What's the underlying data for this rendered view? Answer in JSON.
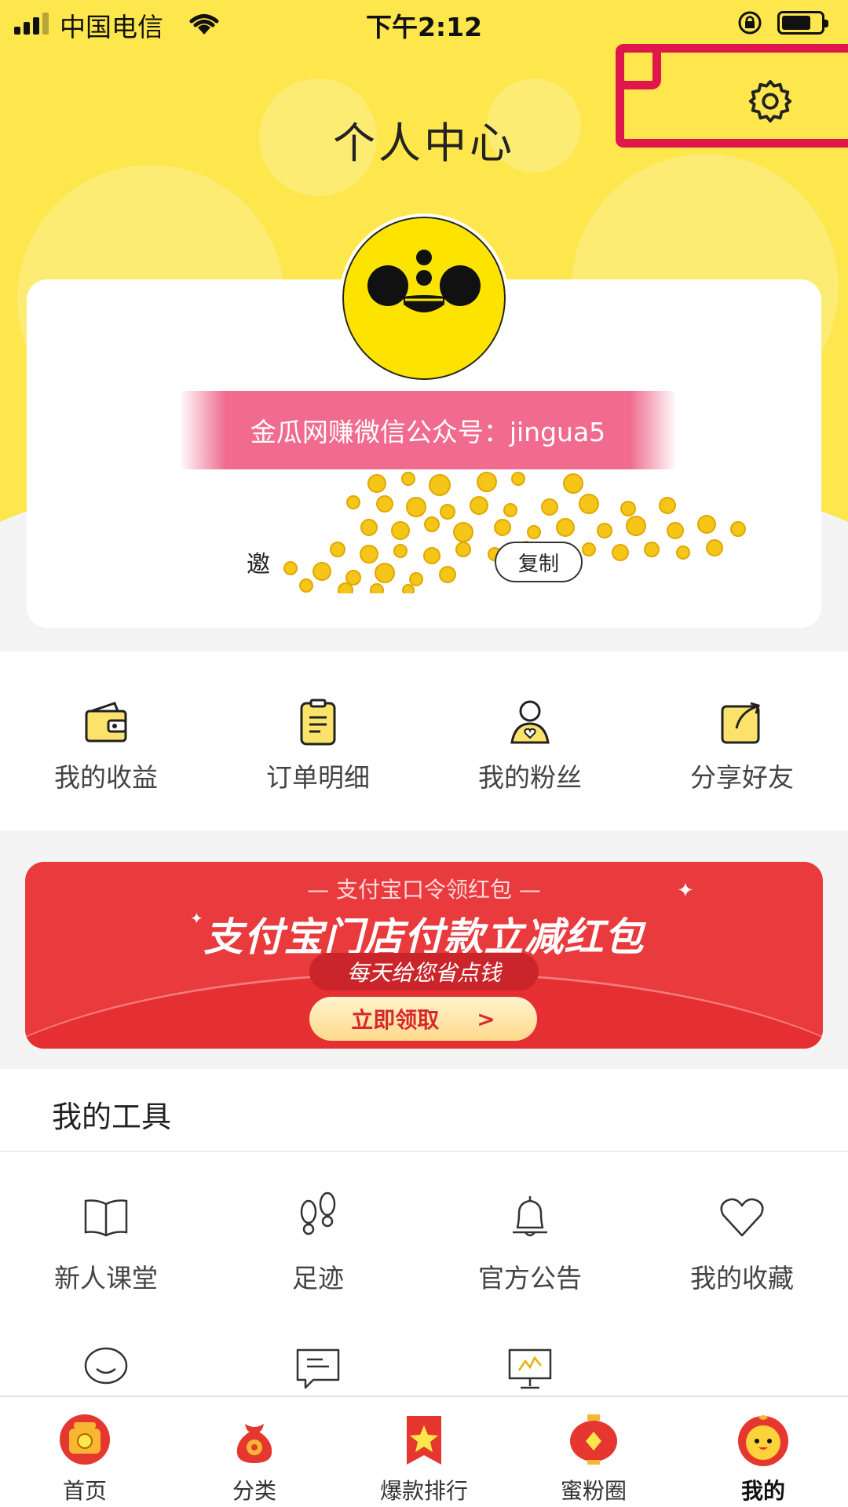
{
  "status_bar": {
    "carrier": "中国电信",
    "time": "下午2:12"
  },
  "header": {
    "title": "个人中心",
    "settings_icon": "gear-icon"
  },
  "profile": {
    "avatar_icon": "mascot-face-avatar",
    "banner_text": "金瓜网赚微信公众号：jingua5",
    "invite_label": "邀",
    "copy_label": "复制"
  },
  "quick_actions": [
    {
      "label": "我的收益",
      "icon": "wallet-icon"
    },
    {
      "label": "订单明细",
      "icon": "clipboard-icon"
    },
    {
      "label": "我的粉丝",
      "icon": "user-heart-icon"
    },
    {
      "label": "分享好友",
      "icon": "share-icon"
    }
  ],
  "promo": {
    "sub": "— 支付宝口令领红包 —",
    "headline": "支付宝门店付款立减红包",
    "pill": "每天给您省点钱",
    "cta": "立即领取",
    "cta_arrow": ">",
    "accent": "#e93a3e"
  },
  "tools": {
    "header": "我的工具",
    "items": [
      {
        "label": "新人课堂",
        "icon": "book-icon"
      },
      {
        "label": "足迹",
        "icon": "footprints-icon"
      },
      {
        "label": "官方公告",
        "icon": "bell-icon"
      },
      {
        "label": "我的收藏",
        "icon": "heart-icon"
      },
      {
        "label": "",
        "icon": "chat-bubble-icon"
      },
      {
        "label": "",
        "icon": "message-icon"
      },
      {
        "label": "",
        "icon": "monitor-chart-icon"
      }
    ]
  },
  "tabbar": {
    "items": [
      {
        "label": "首页",
        "icon": "home-lucky-icon"
      },
      {
        "label": "分类",
        "icon": "money-bag-icon"
      },
      {
        "label": "爆款排行",
        "icon": "star-banner-icon"
      },
      {
        "label": "蜜粉圈",
        "icon": "lantern-icon"
      },
      {
        "label": "我的",
        "icon": "mascot-profile-icon",
        "active": true
      }
    ]
  },
  "colors": {
    "header_yellow": "#fde74c",
    "highlight_red": "#e0174c",
    "banner_pink": "#f06b8e"
  }
}
